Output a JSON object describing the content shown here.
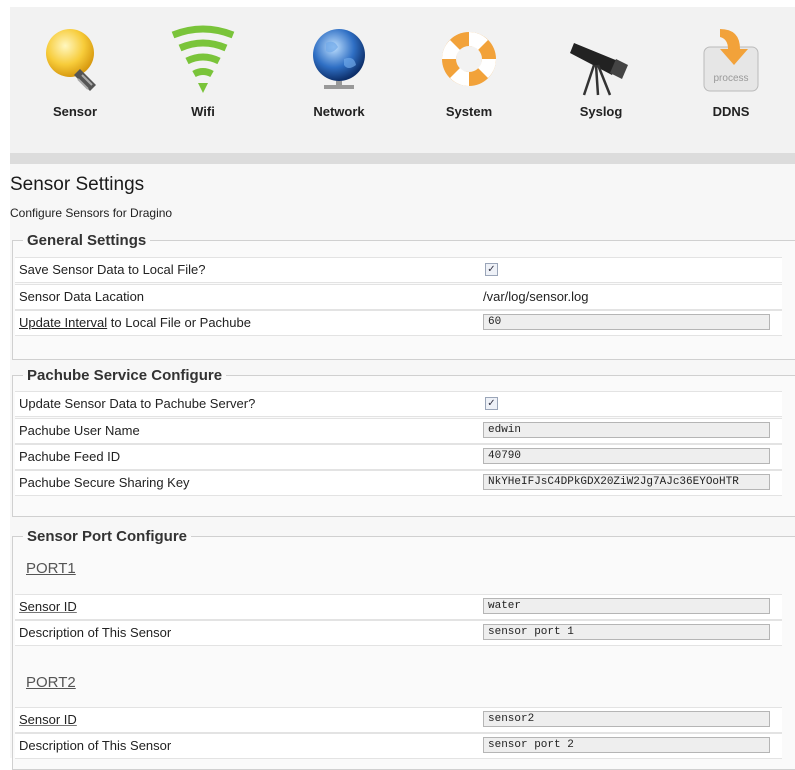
{
  "nav": [
    {
      "label": "Sensor",
      "icon": "lightbulb-icon"
    },
    {
      "label": "Wifi",
      "icon": "wifi-signal-icon"
    },
    {
      "label": "Network",
      "icon": "globe-icon"
    },
    {
      "label": "System",
      "icon": "lifebuoy-icon"
    },
    {
      "label": "Syslog",
      "icon": "telescope-icon"
    },
    {
      "label": "DDNS",
      "icon": "process-arrow-icon"
    }
  ],
  "page": {
    "title": "Sensor Settings",
    "description": "Configure Sensors for Dragino"
  },
  "general": {
    "legend": "General Settings",
    "save_label": "Save Sensor Data to Local File?",
    "save_checked": true,
    "location_label": "Sensor Data Lacation",
    "location_value": "/var/log/sensor.log",
    "interval_label_u": "Update Interval",
    "interval_label_rest": " to Local File or Pachube",
    "interval_value": "60"
  },
  "pachube": {
    "legend": "Pachube Service Configure",
    "update_label": "Update Sensor Data to Pachube Server?",
    "update_checked": true,
    "user_label": "Pachube User Name",
    "user_value": "edwin",
    "feed_label": "Pachube Feed ID",
    "feed_value": "40790",
    "key_label": "Pachube Secure Sharing Key",
    "key_value": "NkYHeIFJsC4DPkGDX20ZiW2Jg7AJc36EYOoHTR"
  },
  "ports": {
    "legend": "Sensor Port Configure",
    "items": [
      {
        "name": "PORT1",
        "id_label": "Sensor ID",
        "id_value": "water",
        "desc_label": "Description of This Sensor",
        "desc_value": "sensor port 1"
      },
      {
        "name": "PORT2",
        "id_label": "Sensor ID",
        "id_value": "sensor2",
        "desc_label": "Description of This Sensor",
        "desc_value": "sensor port 2"
      }
    ]
  },
  "colors": {
    "accent_orange": "#f2a23a",
    "icon_green": "#7ac43a",
    "icon_blue": "#2f6fc4",
    "check_blue": "#334466"
  }
}
